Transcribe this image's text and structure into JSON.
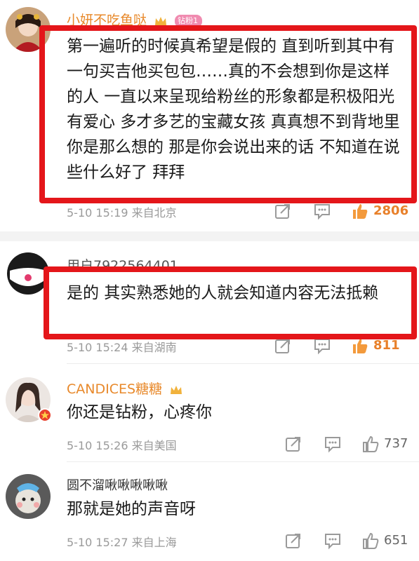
{
  "comments": [
    {
      "username": "小妍不吃鱼哒",
      "badge": "钻粉1",
      "text": "第一遍听的时候真希望是假的 直到听到其中有一句买吉他买包包……真的不会想到你是这样的人 一直以来呈现给粉丝的形象都是积极阳光有爱心 多才多艺的宝藏女孩 真真想不到背地里你是那么想的 那是你会说出来的话 不知道在说些什么好了 拜拜",
      "time": "5-10 15:19",
      "location": "来自北京",
      "likes": "2806"
    },
    {
      "username": "用户7922564401",
      "text": "是的 其实熟悉她的人就会知道内容无法抵赖",
      "time": "5-10 15:24",
      "location": "来自湖南",
      "likes": "811"
    },
    {
      "username": "CANDICES糖糖",
      "text": "你还是钻粉，心疼你",
      "time": "5-10 15:26",
      "location": "来自美国",
      "likes": "737"
    },
    {
      "username": "圆不溜啾啾啾啾啾",
      "text": "那就是她的声音呀",
      "time": "5-10 15:27",
      "location": "来自上海",
      "likes": "651"
    }
  ],
  "colors": {
    "highlight_box": "#e4161a",
    "vip_name": "#e8892b",
    "hot_like": "#e8802a"
  },
  "icons": [
    "share-icon",
    "comment-icon",
    "like-icon",
    "crown-icon",
    "verified-badge-icon"
  ]
}
